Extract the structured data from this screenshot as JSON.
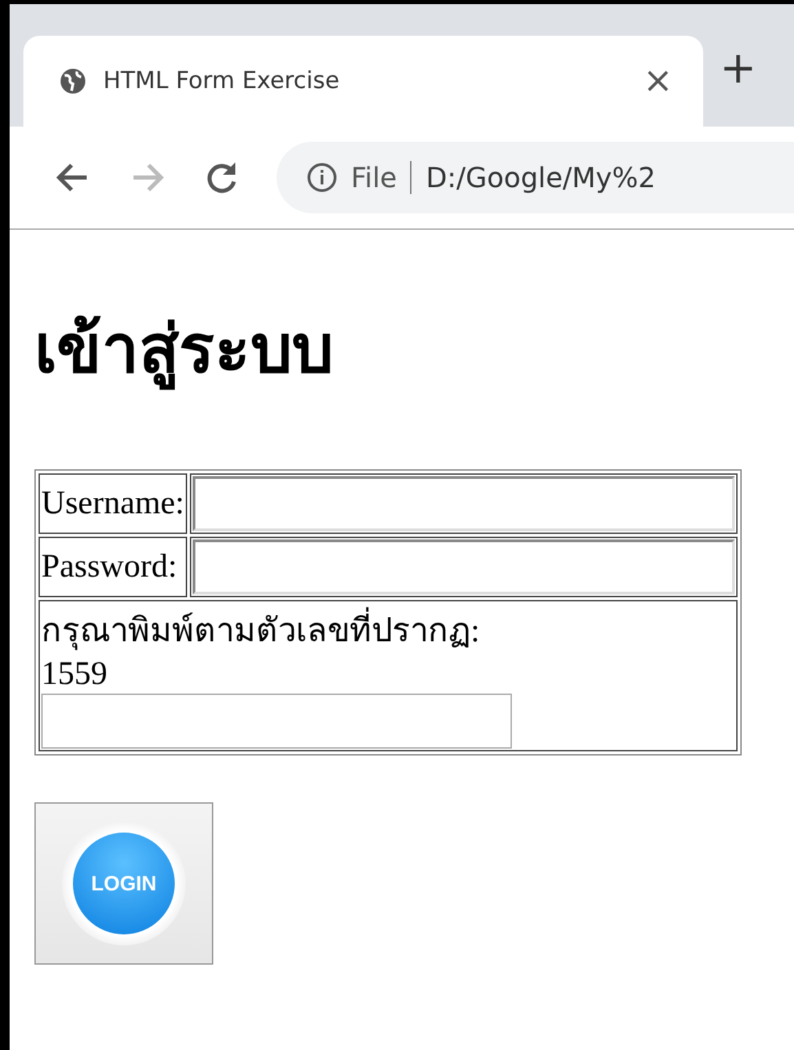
{
  "browser": {
    "tab": {
      "title": "HTML Form Exercise",
      "close": "×"
    },
    "new_tab": "+",
    "address": {
      "scheme": "File",
      "url": "D:/Google/My%2"
    }
  },
  "page": {
    "heading": "เข้าสู่ระบบ",
    "form": {
      "rows": [
        {
          "label": "Username:"
        },
        {
          "label": "Password:"
        }
      ],
      "captcha": {
        "prompt": "กรุณาพิมพ์ตามตัวเลขที่ปรากฏ:",
        "code": "1559"
      },
      "submit": {
        "label": "LOGIN"
      }
    }
  }
}
